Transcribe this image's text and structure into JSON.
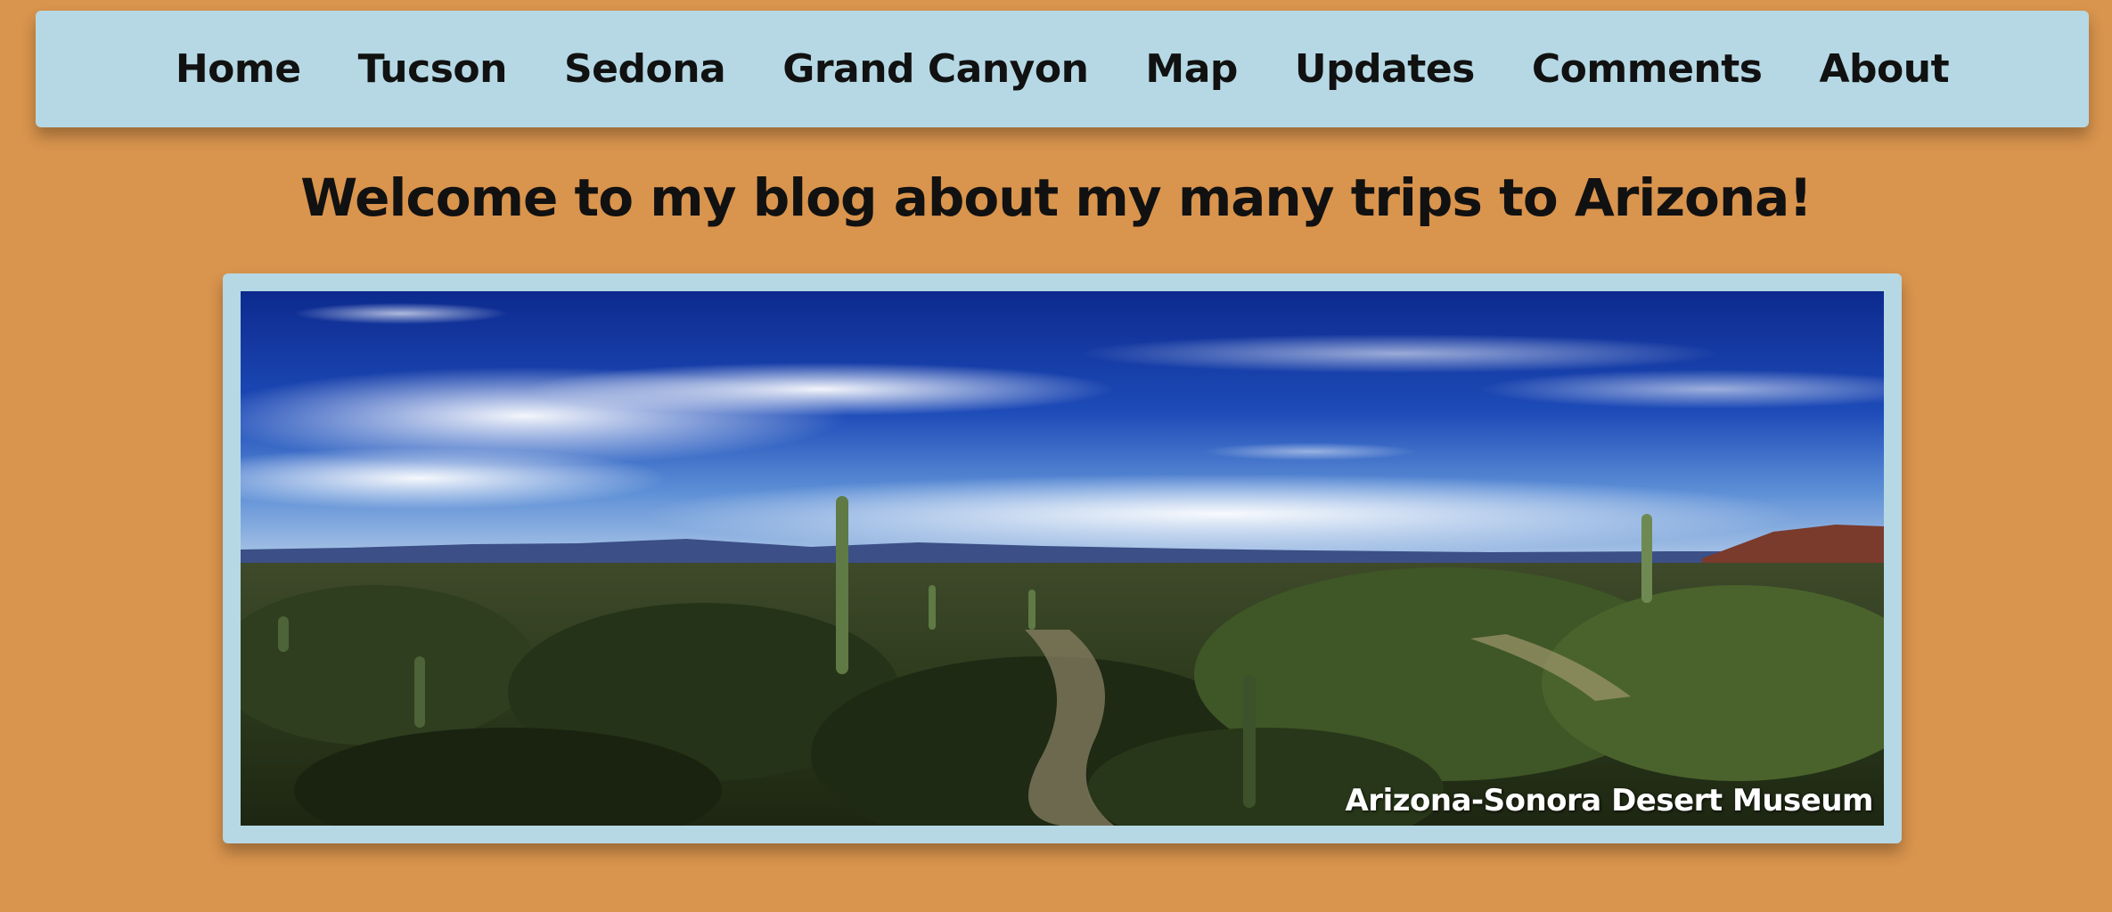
{
  "nav": {
    "items": [
      {
        "label": "Home"
      },
      {
        "label": "Tucson"
      },
      {
        "label": "Sedona"
      },
      {
        "label": "Grand Canyon"
      },
      {
        "label": "Map"
      },
      {
        "label": "Updates"
      },
      {
        "label": "Comments"
      },
      {
        "label": "About"
      }
    ]
  },
  "main": {
    "title": "Welcome to my blog about my many trips to Arizona!",
    "hero": {
      "caption": "Arizona-Sonora Desert Museum"
    }
  },
  "colors": {
    "page_background": "#d9944d",
    "nav_background": "#b5d8e4",
    "frame_background": "#b5d8e4",
    "text": "#111111"
  }
}
